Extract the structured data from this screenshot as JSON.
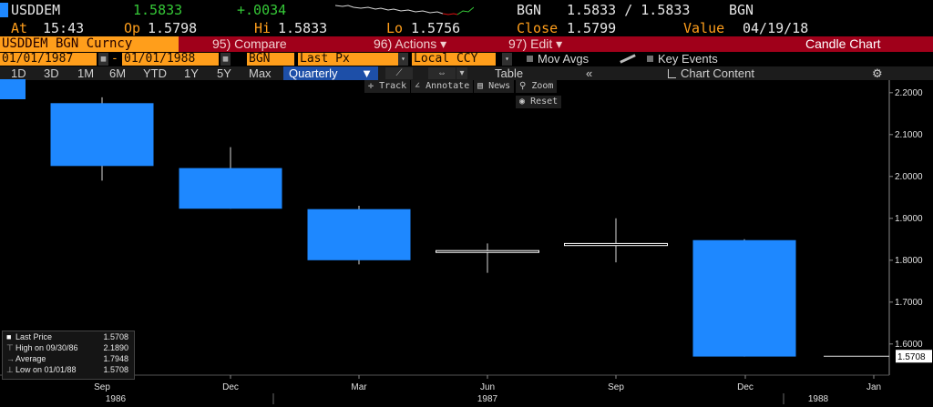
{
  "header": {
    "ticker": "USDDEM",
    "last": "1.5833",
    "change": "+.0034",
    "source": "BGN",
    "bid_ask": "1.5833 / 1.5833",
    "source2": "BGN",
    "at_label": "At",
    "time": "15:43",
    "op_label": "Op",
    "open": "1.5798",
    "hi_label": "Hi",
    "high": "1.5833",
    "lo_label": "Lo",
    "low": "1.5756",
    "close_label": "Close",
    "close": "1.5799",
    "value_label": "Value",
    "value_date": "04/19/18"
  },
  "menu": {
    "ticker_field": "USDDEM BGN Curncy",
    "compare": "95) Compare",
    "actions": "96) Actions",
    "edit": "97) Edit",
    "chart_type": "Candle Chart"
  },
  "controls": {
    "start_date": "01/01/1987",
    "end_date": "01/01/1988",
    "source": "BGN",
    "field": "Last Px",
    "currency": "Local CCY",
    "mov_avgs": "Mov Avgs",
    "key_events": "Key Events"
  },
  "periods": {
    "tabs": [
      "1D",
      "3D",
      "1M",
      "6M",
      "YTD",
      "1Y",
      "5Y",
      "Max"
    ],
    "frequency": "Quarterly",
    "table": "Table",
    "chart_content": "Chart Content"
  },
  "tools": {
    "track": "Track",
    "annotate": "Annotate",
    "news": "News",
    "zoom": "Zoom",
    "reset": "Reset"
  },
  "legend": {
    "last_price_label": "Last Price",
    "last_price": "1.5708",
    "high_label": "High on 09/30/86",
    "high": "2.1890",
    "average_label": "Average",
    "average": "1.7948",
    "low_label": "Low on 01/01/88",
    "low": "1.5708"
  },
  "colors": {
    "up": "#1e88ff",
    "down": "#ffffff",
    "background": "#000000",
    "axis_text": "#e0e0e0",
    "accent": "#ff9e1b"
  },
  "chart_data": {
    "type": "candlestick",
    "frequency": "Quarterly",
    "ylim": [
      1.53,
      2.23
    ],
    "yticks": [
      1.6,
      1.7,
      1.8,
      1.9,
      2.0,
      2.1,
      2.2
    ],
    "ytick_labels": [
      "1.6000",
      "1.7000",
      "1.8000",
      "1.9000",
      "2.0000",
      "2.1000",
      "2.2000"
    ],
    "x_labels": [
      "Sep",
      "Dec",
      "Mar",
      "Jun",
      "Sep",
      "Dec",
      "Jan"
    ],
    "year_labels": [
      "1986",
      "1987",
      "1988"
    ],
    "candles": [
      {
        "open": 2.025,
        "high": 2.189,
        "low": 1.99,
        "close": 2.175
      },
      {
        "open": 1.923,
        "high": 2.07,
        "low": 1.923,
        "close": 2.02
      },
      {
        "open": 1.8,
        "high": 1.93,
        "low": 1.79,
        "close": 1.922
      },
      {
        "open": 1.82,
        "high": 1.84,
        "low": 1.77,
        "close": 1.823
      },
      {
        "open": 1.835,
        "high": 1.9,
        "low": 1.795,
        "close": 1.84
      },
      {
        "open": 1.57,
        "high": 1.85,
        "low": 1.57,
        "close": 1.848
      }
    ],
    "last_price": 1.5708,
    "last_price_label": "1.5708"
  }
}
